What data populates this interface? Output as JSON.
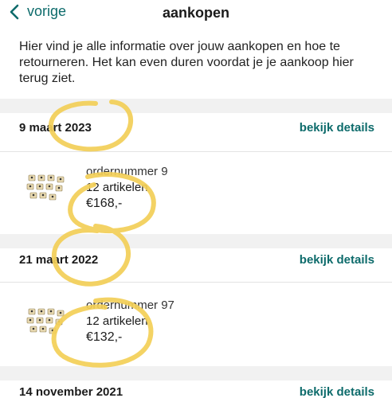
{
  "nav": {
    "back_label": "vorige",
    "title": "aankopen"
  },
  "intro": "Hier vind je alle informatie over jouw aankopen en hoe te retourneren. Het kan even duren voordat je je aankoop hier terug ziet.",
  "orders": [
    {
      "date": "9 maart 2023",
      "details_label": "bekijk details",
      "order_number": "ordernummer 9",
      "items": "12 artikelen",
      "price": "€168,-"
    },
    {
      "date": "21 maart 2022",
      "details_label": "bekijk details",
      "order_number": "ordernummer 97",
      "items": "12 artikelen",
      "price": "€132,-"
    },
    {
      "date": "14 november 2021",
      "details_label": "bekijk details"
    }
  ],
  "colors": {
    "accent": "#0d6b6b",
    "scribble": "#f3cf57",
    "band": "#f1f1f1"
  }
}
